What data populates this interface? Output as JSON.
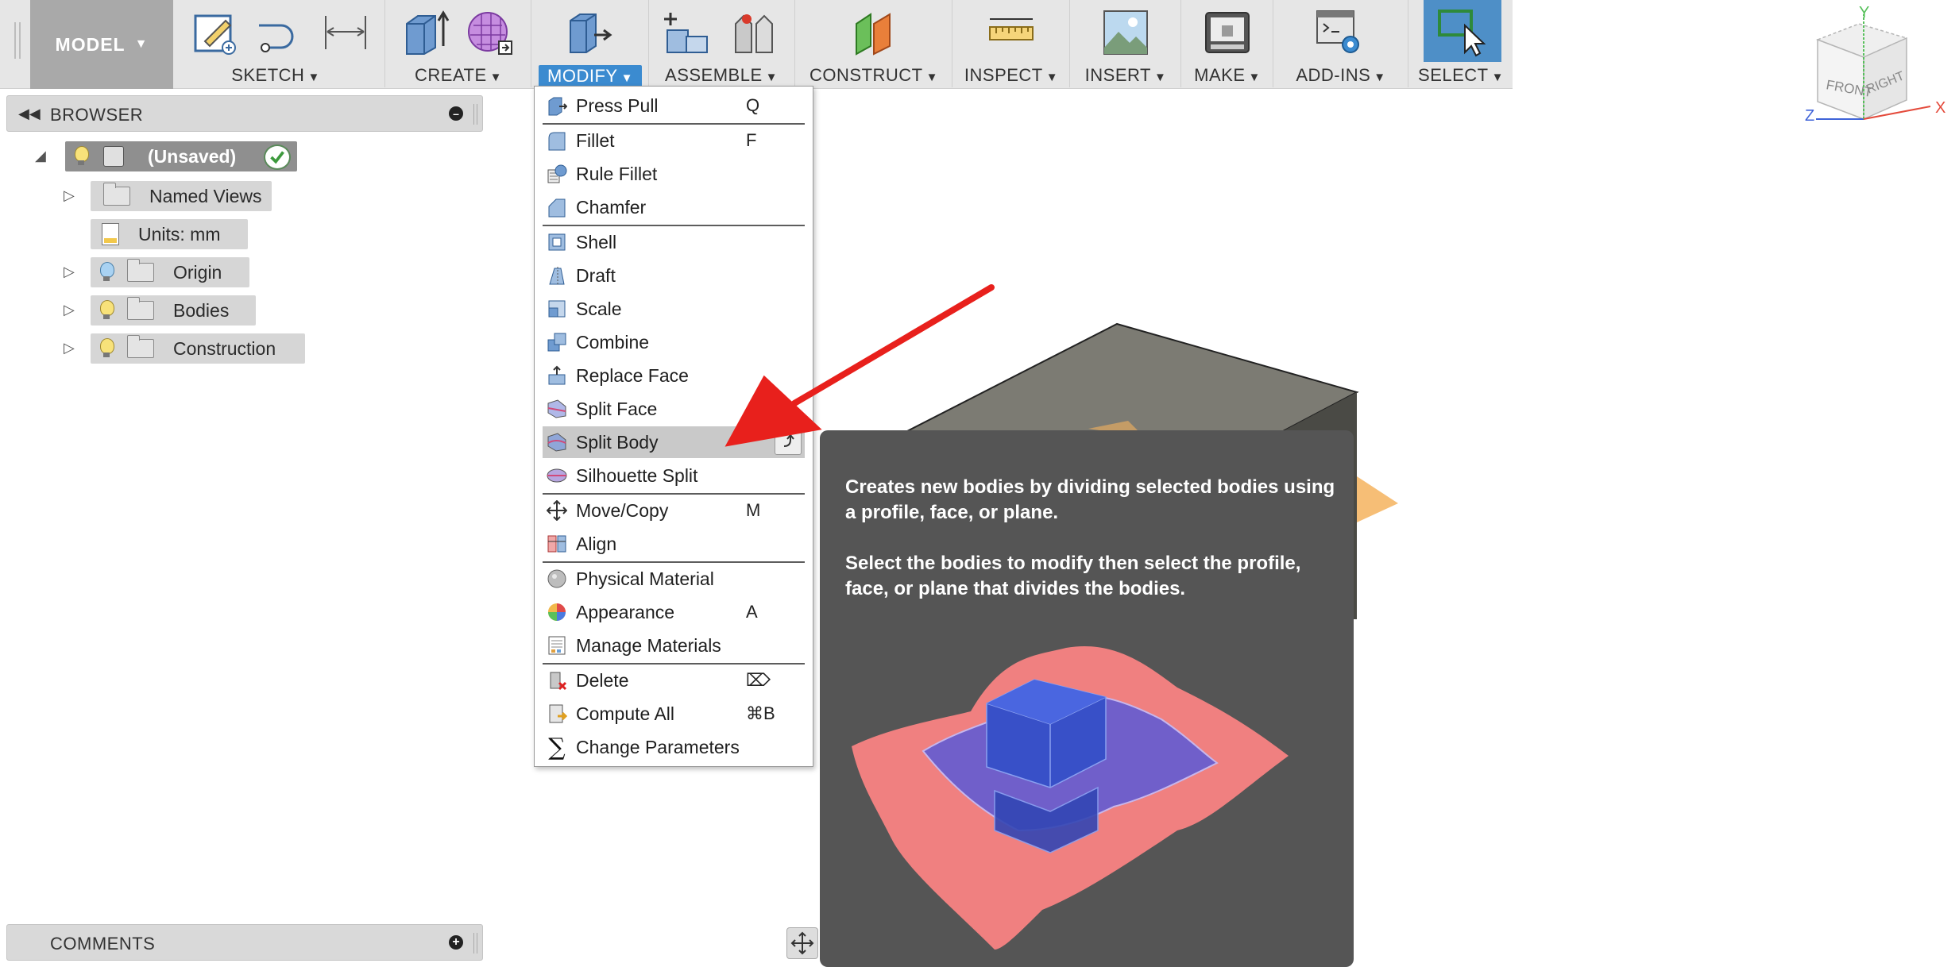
{
  "toolbar": {
    "model_label": "MODEL",
    "groups": [
      {
        "label": "SKETCH"
      },
      {
        "label": "CREATE"
      },
      {
        "label": "MODIFY"
      },
      {
        "label": "ASSEMBLE"
      },
      {
        "label": "CONSTRUCT"
      },
      {
        "label": "INSPECT"
      },
      {
        "label": "INSERT"
      },
      {
        "label": "MAKE"
      },
      {
        "label": "ADD-INS"
      },
      {
        "label": "SELECT"
      }
    ],
    "active_group": "MODIFY",
    "accent_color": "#3b8bd0"
  },
  "browser": {
    "title": "BROWSER",
    "root": "(Unsaved)",
    "items": [
      {
        "label": "Named Views"
      },
      {
        "label": "Units: mm"
      },
      {
        "label": "Origin"
      },
      {
        "label": "Bodies"
      },
      {
        "label": "Construction"
      }
    ]
  },
  "menu": {
    "items": [
      {
        "label": "Press Pull",
        "shortcut": "Q"
      },
      {
        "label": "Fillet",
        "shortcut": "F"
      },
      {
        "label": "Rule Fillet",
        "shortcut": ""
      },
      {
        "label": "Chamfer",
        "shortcut": ""
      },
      {
        "label": "Shell",
        "shortcut": ""
      },
      {
        "label": "Draft",
        "shortcut": ""
      },
      {
        "label": "Scale",
        "shortcut": ""
      },
      {
        "label": "Combine",
        "shortcut": ""
      },
      {
        "label": "Replace Face",
        "shortcut": ""
      },
      {
        "label": "Split Face",
        "shortcut": ""
      },
      {
        "label": "Split Body",
        "shortcut": ""
      },
      {
        "label": "Silhouette Split",
        "shortcut": ""
      },
      {
        "label": "Move/Copy",
        "shortcut": "M"
      },
      {
        "label": "Align",
        "shortcut": ""
      },
      {
        "label": "Physical Material",
        "shortcut": ""
      },
      {
        "label": "Appearance",
        "shortcut": "A"
      },
      {
        "label": "Manage Materials",
        "shortcut": ""
      },
      {
        "label": "Delete",
        "shortcut": "⌦"
      },
      {
        "label": "Compute All",
        "shortcut": "⌘B"
      },
      {
        "label": "Change Parameters",
        "shortcut": ""
      }
    ],
    "highlighted": "Split Body"
  },
  "tooltip": {
    "line1": "Creates new bodies by dividing selected bodies using a profile, face, or plane.",
    "line2": "Select the bodies to modify then select the profile, face, or plane that divides the bodies."
  },
  "viewcube": {
    "front": "FRONT",
    "right": "RIGHT",
    "axis_x": "X",
    "axis_y": "Y",
    "axis_z": "Z"
  },
  "comments": {
    "title": "COMMENTS"
  },
  "colors": {
    "arrow": "#e8201c",
    "tooltip_bg": "#555555",
    "body_gray": "#7c7b73",
    "plane_orange": "#f5b35e"
  }
}
